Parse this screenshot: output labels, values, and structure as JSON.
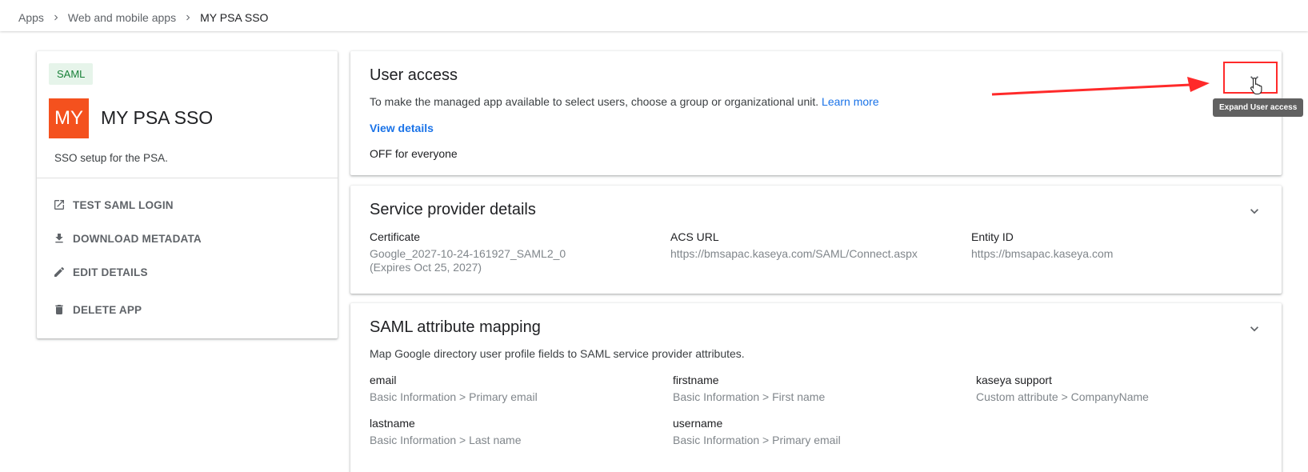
{
  "breadcrumb": {
    "items": [
      "Apps",
      "Web and mobile apps"
    ],
    "current": "MY PSA SSO"
  },
  "app": {
    "type_chip": "SAML",
    "logo_text": "MY",
    "logo_color": "#f4511e",
    "name": "MY PSA SSO",
    "description": "SSO setup for the PSA.",
    "actions": [
      {
        "label": "TEST SAML LOGIN",
        "icon": "open-in-new-icon"
      },
      {
        "label": "DOWNLOAD METADATA",
        "icon": "download-icon"
      },
      {
        "label": "EDIT DETAILS",
        "icon": "pencil-icon"
      },
      {
        "label": "DELETE APP",
        "icon": "trash-icon"
      }
    ]
  },
  "user_access": {
    "title": "User access",
    "description": "To make the managed app available to select users, choose a group or organizational unit.",
    "learn_more": "Learn more",
    "view_details": "View details",
    "status": "OFF for everyone",
    "tooltip": "Expand User access"
  },
  "service_provider": {
    "title": "Service provider details",
    "fields": [
      {
        "label": "Certificate",
        "value_line1": "Google_2027-10-24-161927_SAML2_0",
        "value_line2": "(Expires Oct 25, 2027)"
      },
      {
        "label": "ACS URL",
        "value_line1": "https://bmsapac.kaseya.com/SAML/Connect.aspx"
      },
      {
        "label": "Entity ID",
        "value_line1": "https://bmsapac.kaseya.com"
      }
    ]
  },
  "attribute_mapping": {
    "title": "SAML attribute mapping",
    "description": "Map Google directory user profile fields to SAML service provider attributes.",
    "mappings": [
      {
        "label": "email",
        "value": "Basic Information > Primary email"
      },
      {
        "label": "firstname",
        "value": "Basic Information > First name"
      },
      {
        "label": "kaseya support",
        "value": "Custom attribute > CompanyName"
      },
      {
        "label": "lastname",
        "value": "Basic Information > Last name"
      },
      {
        "label": "username",
        "value": "Basic Information > Primary email"
      }
    ]
  },
  "colors": {
    "accent": "#1a73e8",
    "chip_bg": "#e6f4ea",
    "chip_text": "#188038",
    "annotation": "#ff2a2a"
  }
}
